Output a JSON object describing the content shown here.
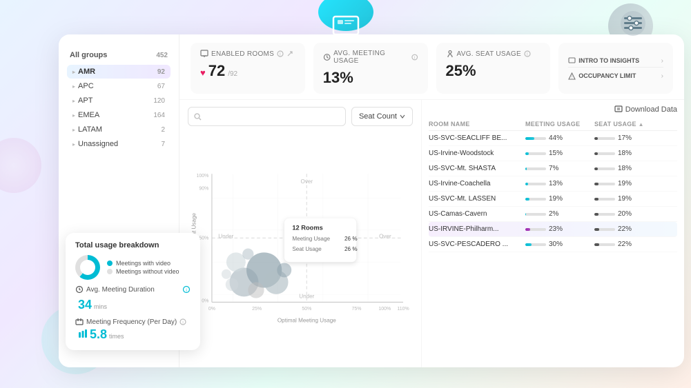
{
  "decorative": {
    "blobs": [
      "top-center-teal",
      "top-right-gray",
      "bottom-left-cyan",
      "mid-left-purple"
    ]
  },
  "sidebar": {
    "all_groups_label": "All groups",
    "all_groups_count": "452",
    "groups": [
      {
        "name": "AMR",
        "count": "92",
        "active": true
      },
      {
        "name": "APC",
        "count": "67",
        "active": false
      },
      {
        "name": "APT",
        "count": "120",
        "active": false
      },
      {
        "name": "EMEA",
        "count": "164",
        "active": false
      },
      {
        "name": "LATAM",
        "count": "2",
        "active": false
      },
      {
        "name": "Unassigned",
        "count": "7",
        "active": false
      }
    ],
    "icons": [
      "home",
      "file",
      "camera",
      "grid",
      "cloud",
      "lightbulb",
      "sliders",
      "printer",
      "settings"
    ]
  },
  "stats": {
    "enabled_rooms": {
      "title": "Enabled Rooms",
      "value": "72",
      "total": "/92",
      "icon": "heart"
    },
    "avg_meeting_usage": {
      "title": "Avg. Meeting Usage",
      "value": "13%",
      "icon": "info"
    },
    "avg_seat_usage": {
      "title": "Avg. Seat Usage",
      "value": "25%",
      "icon": "info"
    },
    "insights": {
      "items": [
        {
          "label": "INTRO TO INSIGHTS",
          "icon": "monitor"
        },
        {
          "label": "OCCUPANCY LIMIT",
          "icon": "alert"
        }
      ]
    }
  },
  "chart": {
    "search_placeholder": "Search...",
    "seat_count_label": "Seat Count",
    "x_labels": [
      "0%",
      "25%",
      "50%",
      "75%",
      "100%",
      "110%"
    ],
    "y_labels": [
      "0%",
      "50%",
      "90%",
      "100%"
    ],
    "x_axis_label": "Optimal Meeting Usage",
    "y_axis_label": "Optimal Seat Usage",
    "x_under": "Under",
    "x_over": "Over",
    "y_under": "Under",
    "y_over": "Over",
    "tooltip": {
      "rooms": "12 Rooms",
      "meeting_usage_label": "Meeting Usage",
      "meeting_usage_value": "26 %",
      "seat_usage_label": "Seat Usage",
      "seat_usage_value": "26 %"
    },
    "download_label": "Download Data"
  },
  "table": {
    "columns": [
      "ROOM NAME",
      "MEETING USAGE",
      "SEAT USAGE"
    ],
    "rows": [
      {
        "name": "US-SVC-SEACLIFF BE...",
        "meeting_pct": "44%",
        "meeting_bar": 44,
        "seat_pct": "17%",
        "seat_bar": 17,
        "highlighted": false
      },
      {
        "name": "US-Irvine-Woodstock",
        "meeting_pct": "15%",
        "meeting_bar": 15,
        "seat_pct": "18%",
        "seat_bar": 18,
        "highlighted": false
      },
      {
        "name": "US-SVC-Mt. SHASTA",
        "meeting_pct": "7%",
        "meeting_bar": 7,
        "seat_pct": "18%",
        "seat_bar": 18,
        "highlighted": false
      },
      {
        "name": "US-Irvine-Coachella",
        "meeting_pct": "13%",
        "meeting_bar": 13,
        "seat_pct": "19%",
        "seat_bar": 19,
        "highlighted": false
      },
      {
        "name": "US-SVC-Mt. LASSEN",
        "meeting_pct": "19%",
        "meeting_bar": 19,
        "seat_pct": "19%",
        "seat_bar": 19,
        "highlighted": false
      },
      {
        "name": "US-Camas-Cavern",
        "meeting_pct": "2%",
        "meeting_bar": 2,
        "seat_pct": "20%",
        "seat_bar": 20,
        "highlighted": false
      },
      {
        "name": "US-IRVINE-Philharm...",
        "meeting_pct": "23%",
        "meeting_bar": 23,
        "seat_pct": "22%",
        "seat_bar": 22,
        "highlighted": true
      },
      {
        "name": "US-SVC-PESCADERO ...",
        "meeting_pct": "30%",
        "meeting_bar": 30,
        "seat_pct": "22%",
        "seat_bar": 22,
        "highlighted": false
      }
    ]
  },
  "usage_breakdown": {
    "title": "Total usage breakdown",
    "legend": [
      {
        "label": "Meetings with video",
        "color": "#00bcd4"
      },
      {
        "label": "Meetings without video",
        "color": "#e0e0e0"
      }
    ],
    "avg_duration_label": "Avg. Meeting Duration",
    "avg_duration_value": "34",
    "avg_duration_unit": "mins",
    "frequency_label": "Meeting Frequency (Per Day)",
    "frequency_value": "5.8",
    "frequency_unit": "times",
    "frequency_icon": "info"
  },
  "colors": {
    "accent_cyan": "#00bcd4",
    "accent_purple": "#9c27b0",
    "accent_teal": "#26c6da",
    "background": "#f0f4ff",
    "card_bg": "#ffffff",
    "highlight_row": "rgba(138,43,226,0.06)"
  }
}
